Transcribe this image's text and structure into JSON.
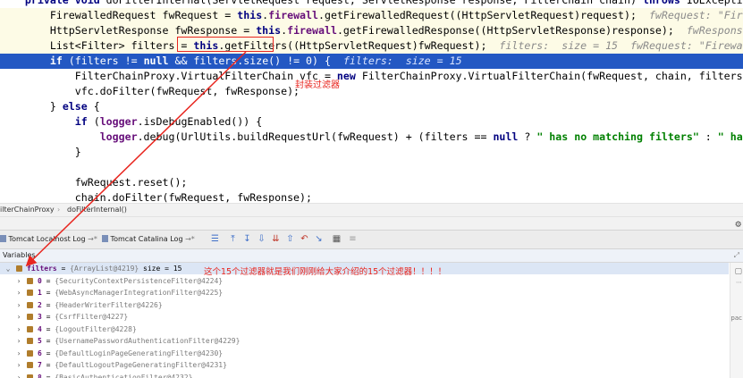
{
  "code": {
    "lines": [
      {
        "segments": [
          {
            "t": "    ",
            "c": ""
          },
          {
            "t": "private void ",
            "c": "kw"
          },
          {
            "t": "doFilterInternal(ServletRequest request, ServletResponse response, FilterChain chain) ",
            "c": ""
          },
          {
            "t": "throws ",
            "c": "kw"
          },
          {
            "t": "IOException, S",
            "c": ""
          }
        ]
      },
      {
        "segments": [
          {
            "t": "        FirewalledRequest fwRequest = ",
            "c": ""
          },
          {
            "t": "this",
            "c": "kw"
          },
          {
            "t": ".",
            "c": ""
          },
          {
            "t": "firewall",
            "c": "fld"
          },
          {
            "t": ".getFirewalledRequest((HttpServletRequest)request);  ",
            "c": ""
          },
          {
            "t": "fwRequest: \"Firewal",
            "c": "inl"
          }
        ]
      },
      {
        "segments": [
          {
            "t": "        HttpServletResponse fwResponse = ",
            "c": ""
          },
          {
            "t": "this",
            "c": "kw"
          },
          {
            "t": ".",
            "c": ""
          },
          {
            "t": "firewall",
            "c": "fld"
          },
          {
            "t": ".getFirewalledResponse((HttpServletResponse)response);  ",
            "c": ""
          },
          {
            "t": "fwResponse: F",
            "c": "inl"
          }
        ]
      },
      {
        "segments": [
          {
            "t": "        List<Filter> filters = ",
            "c": ""
          },
          {
            "t": "this",
            "c": "kw"
          },
          {
            "t": ".getFilters",
            "c": ""
          },
          {
            "t": "((HttpServletRequest)fwRequest);  ",
            "c": ""
          },
          {
            "t": "filters:  size = 15  fwRequest: \"FirewalledR",
            "c": "inl"
          }
        ]
      },
      {
        "segments": [
          {
            "t": "        ",
            "c": ""
          },
          {
            "t": "if ",
            "c": "kw"
          },
          {
            "t": "(filters != ",
            "c": ""
          },
          {
            "t": "null ",
            "c": "kw"
          },
          {
            "t": "&& filters.size() != 0) {  ",
            "c": ""
          },
          {
            "t": "filters:  size = 15",
            "c": "inl"
          }
        ]
      },
      {
        "segments": [
          {
            "t": "            FilterChainProxy.VirtualFilterChain vfc = ",
            "c": ""
          },
          {
            "t": "new ",
            "c": "kw"
          },
          {
            "t": "FilterChainProxy.VirtualFilterChain(fwRequest, chain, filters);",
            "c": ""
          }
        ]
      },
      {
        "segments": [
          {
            "t": "            vfc.doFilter(fwRequest, fwResponse);",
            "c": ""
          }
        ]
      },
      {
        "segments": [
          {
            "t": "        } ",
            "c": ""
          },
          {
            "t": "else ",
            "c": "kw"
          },
          {
            "t": "{",
            "c": ""
          }
        ]
      },
      {
        "segments": [
          {
            "t": "            ",
            "c": ""
          },
          {
            "t": "if ",
            "c": "kw"
          },
          {
            "t": "(",
            "c": ""
          },
          {
            "t": "logger",
            "c": "fld"
          },
          {
            "t": ".isDebugEnabled()) {",
            "c": ""
          }
        ]
      },
      {
        "segments": [
          {
            "t": "                ",
            "c": ""
          },
          {
            "t": "logger",
            "c": "fld"
          },
          {
            "t": ".debug(UrlUtils.buildRequestUrl(fwRequest) + (filters == ",
            "c": ""
          },
          {
            "t": "null ",
            "c": "kw"
          },
          {
            "t": "? ",
            "c": ""
          },
          {
            "t": "\" has no matching filters\" ",
            "c": "str"
          },
          {
            "t": ": ",
            "c": ""
          },
          {
            "t": "\" has an",
            "c": "str"
          }
        ]
      },
      {
        "segments": [
          {
            "t": "            }",
            "c": ""
          }
        ]
      },
      {
        "segments": [
          {
            "t": "",
            "c": ""
          }
        ]
      },
      {
        "segments": [
          {
            "t": "            fwRequest.reset();",
            "c": ""
          }
        ]
      },
      {
        "segments": [
          {
            "t": "            chain.doFilter(fwRequest, fwResponse);",
            "c": ""
          }
        ]
      },
      {
        "segments": [
          {
            "t": "        }",
            "c": ""
          }
        ]
      },
      {
        "segments": [
          {
            "t": "    }",
            "c": ""
          }
        ]
      }
    ],
    "annotation_wrap": "封装过滤器",
    "annotation_filters": "这个15个过滤器就是我们刚刚给大家介绍的15个过滤器！！！！"
  },
  "breadcrumb": {
    "class_name": "ilterChainProxy",
    "separator": "›",
    "method_name": "doFilterInternal()"
  },
  "toolbar": {
    "tab1_label": "Tomcat Localhost Log",
    "tab2_label": "Tomcat Catalina Log",
    "tab_suffix": "→*"
  },
  "variables": {
    "header": "Variables",
    "root": {
      "name": "filters",
      "eq": " = ",
      "value": "{ArrayList@4219}",
      "extra": "  size = 15"
    },
    "items": [
      {
        "idx": "0",
        "value": "{SecurityContextPersistenceFilter@4224}"
      },
      {
        "idx": "1",
        "value": "{WebAsyncManagerIntegrationFilter@4225}"
      },
      {
        "idx": "2",
        "value": "{HeaderWriterFilter@4226}"
      },
      {
        "idx": "3",
        "value": "{CsrfFilter@4227}"
      },
      {
        "idx": "4",
        "value": "{LogoutFilter@4228}"
      },
      {
        "idx": "5",
        "value": "{UsernamePasswordAuthenticationFilter@4229}"
      },
      {
        "idx": "6",
        "value": "{DefaultLoginPageGeneratingFilter@4230}"
      },
      {
        "idx": "7",
        "value": "{DefaultLogoutPageGeneratingFilter@4231}"
      },
      {
        "idx": "8",
        "value": "{BasicAuthenticationFilter@4232}"
      }
    ],
    "side_label": "pac"
  },
  "colors": {
    "accent_red": "#e8261f",
    "selection_blue": "#2358c3"
  }
}
